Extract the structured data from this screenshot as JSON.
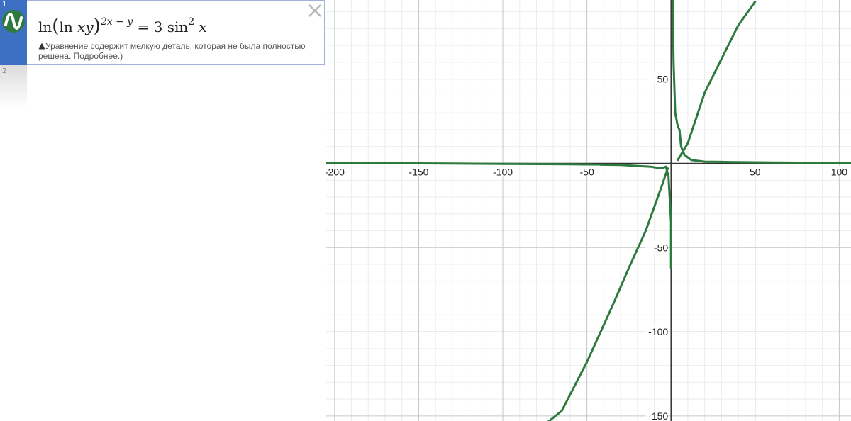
{
  "expression_list": {
    "items": [
      {
        "index": "1",
        "formula": {
          "ln1": "ln",
          "open_paren": "(",
          "ln2": "ln",
          "arg": "xy",
          "close_paren": ")",
          "exponent": "2x − y",
          "equals": "= 3",
          "sin": "sin",
          "sin_exp": "2",
          "var": "x"
        },
        "color": "#2d7a3e",
        "warning": {
          "text": "Уравнение содержит мелкую деталь, которая не была полностью решена.",
          "link": "Подробнее.)"
        }
      },
      {
        "index": "2"
      }
    ]
  },
  "graph": {
    "x_ticks": [
      "-200",
      "-150",
      "-100",
      "-50",
      "50",
      "100"
    ],
    "y_ticks": [
      "50",
      "-50",
      "-100",
      "-150"
    ],
    "grid": true,
    "curve_color": "#2d7a3e"
  },
  "chart_data": {
    "type": "line",
    "title": "",
    "xlabel": "",
    "ylabel": "",
    "xlim": [
      -205,
      107
    ],
    "ylim": [
      -153,
      97
    ],
    "x_ticks": [
      -200,
      -150,
      -100,
      -50,
      50,
      100
    ],
    "y_ticks": [
      50,
      -50,
      -100,
      -150
    ],
    "grid": true,
    "series": [
      {
        "points": [
          [
            1,
            120
          ],
          [
            1,
            99
          ],
          [
            1.5,
            60
          ],
          [
            2.5,
            30
          ],
          [
            4,
            22
          ],
          [
            5,
            20
          ],
          [
            6,
            10
          ],
          [
            8,
            5
          ],
          [
            12,
            2
          ],
          [
            20,
            1
          ],
          [
            35,
            0.8
          ],
          [
            60,
            0.5
          ],
          [
            100,
            0.3
          ],
          [
            107,
            0.3
          ]
        ]
      },
      {
        "points": [
          [
            4,
            2
          ],
          [
            10,
            12
          ],
          [
            20,
            42
          ],
          [
            30,
            62
          ],
          [
            40,
            82
          ],
          [
            50,
            96
          ]
        ]
      },
      {
        "points": [
          [
            -205,
            0
          ],
          [
            -150,
            0
          ],
          [
            -100,
            -0.3
          ],
          [
            -60,
            -0.5
          ],
          [
            -30,
            -1
          ],
          [
            -12,
            -2
          ],
          [
            -6,
            -3
          ],
          [
            -3,
            -2
          ],
          [
            -1.5,
            -8
          ],
          [
            0,
            -35
          ],
          [
            0,
            -62
          ]
        ]
      },
      {
        "points": [
          [
            -2,
            -3
          ],
          [
            -5,
            -12
          ],
          [
            -15,
            -40
          ],
          [
            -25,
            -62
          ],
          [
            -35,
            -85
          ],
          [
            -50,
            -118
          ],
          [
            -65,
            -147
          ],
          [
            -75,
            -155
          ]
        ]
      }
    ]
  }
}
